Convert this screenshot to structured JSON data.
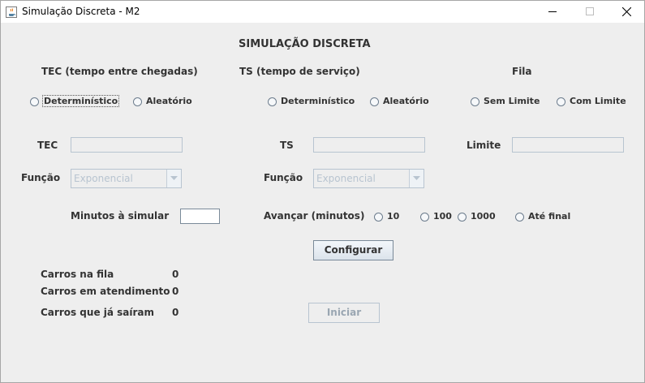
{
  "window": {
    "title": "Simulação Discreta - M2"
  },
  "main": {
    "heading": "SIMULAÇÃO DISCRETA",
    "tec_group_label": "TEC (tempo entre chegadas)",
    "ts_group_label": "TS (tempo de serviço)",
    "fila_group_label": "Fila"
  },
  "tec_options": {
    "deterministico": "Determinístico",
    "aleatorio": "Aleatório"
  },
  "ts_options": {
    "deterministico": "Determinístico",
    "aleatorio": "Aleatório"
  },
  "fila_options": {
    "sem_limite": "Sem Limite",
    "com_limite": "Com Limite"
  },
  "fields": {
    "tec_label": "TEC",
    "tec_value": "",
    "ts_label": "TS",
    "ts_value": "",
    "limite_label": "Limite",
    "limite_value": "",
    "funcao_label_tec": "Função",
    "funcao_label_ts": "Função",
    "funcao_tec_value": "Exponencial",
    "funcao_ts_value": "Exponencial",
    "minutos_label": "Minutos à simular",
    "minutos_value": "",
    "avancar_label": "Avançar (minutos)"
  },
  "avancar_options": [
    "10",
    "100",
    "1000",
    "Até final"
  ],
  "buttons": {
    "configurar": "Configurar",
    "iniciar": "Iniciar"
  },
  "stats": [
    {
      "label": "Carros na fila",
      "value": "0"
    },
    {
      "label": "Carros em atendimento",
      "value": "0"
    },
    {
      "label": "Carros que já saíram",
      "value": "0"
    }
  ],
  "colors": {
    "background": "#eeeeee",
    "text": "#333333",
    "disabled": "#b8c4d0"
  }
}
